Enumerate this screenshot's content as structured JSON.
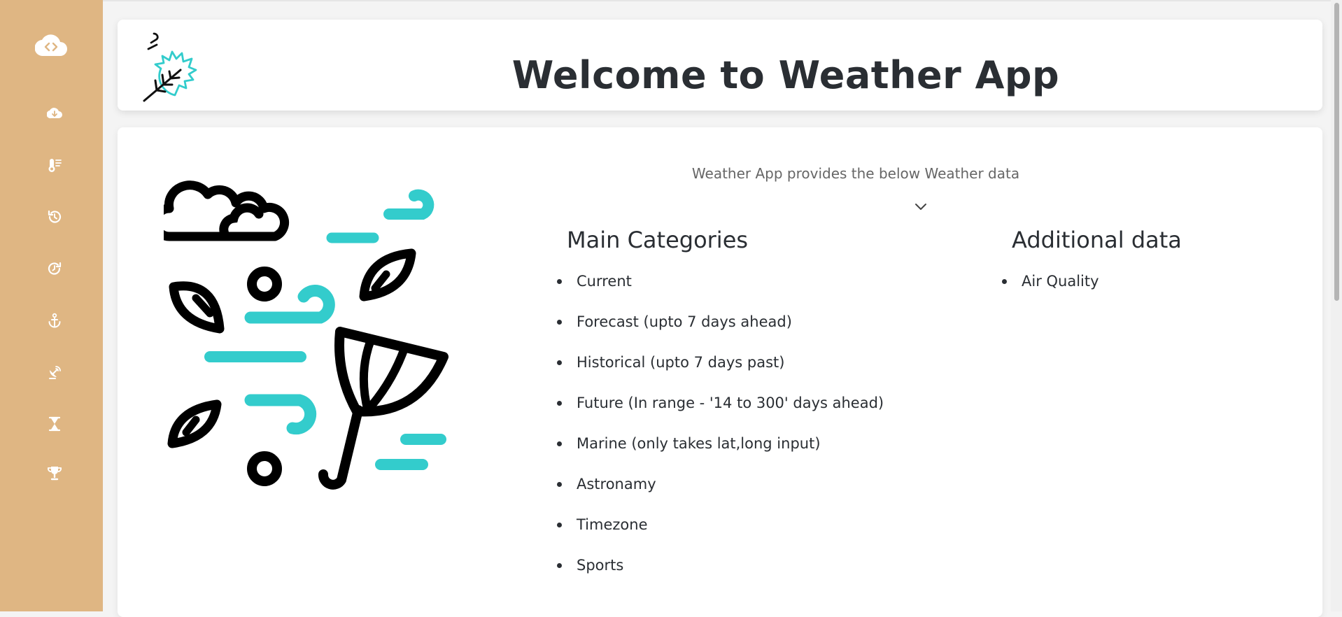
{
  "app": {
    "title": "Welcome to Weather App",
    "intro": "Weather App provides the below Weather data"
  },
  "sidebar": {
    "logo_icon": "cloud-code-icon",
    "items": [
      {
        "icon": "cloud-download-icon"
      },
      {
        "icon": "thermometer-icon"
      },
      {
        "icon": "history-icon"
      },
      {
        "icon": "future-clock-icon"
      },
      {
        "icon": "anchor-icon"
      },
      {
        "icon": "satellite-dish-icon"
      },
      {
        "icon": "hourglass-icon"
      },
      {
        "icon": "trophy-icon"
      }
    ]
  },
  "main_categories": {
    "title": "Main Categories",
    "items": [
      "Current",
      "Forecast (upto 7 days ahead)",
      "Historical (upto 7 days past)",
      "Future (In range - '14 to 300' days ahead)",
      "Marine (only takes lat,long input)",
      "Astronamy",
      "Timezone",
      "Sports"
    ]
  },
  "additional_data": {
    "title": "Additional data",
    "items": [
      "Air Quality"
    ]
  },
  "colors": {
    "sidebar_bg": "#dfb683",
    "accent": "#33cccc",
    "text": "#2a2e33",
    "muted": "#666666"
  }
}
